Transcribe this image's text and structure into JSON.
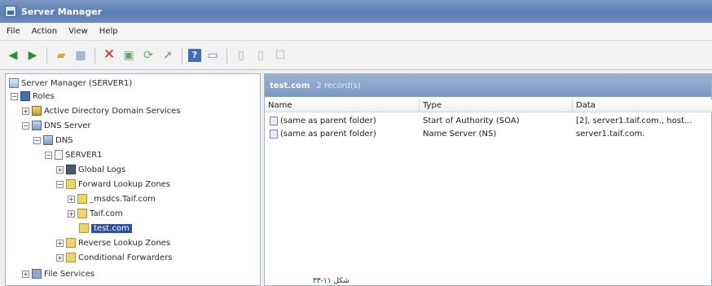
{
  "window": {
    "title": "Server Manager"
  },
  "menubar": {
    "items": [
      "File",
      "Action",
      "View",
      "Help"
    ]
  },
  "toolbar": {
    "back": "back-arrow-icon",
    "forward": "forward-arrow-icon",
    "up": "up-folder-icon",
    "show_hide": "show-hide-tree-icon",
    "delete": "delete-icon",
    "properties": "properties-icon",
    "refresh": "refresh-icon",
    "export": "export-list-icon",
    "help": "help-icon",
    "new_window": "new-window-icon"
  },
  "tree": {
    "root": "Server Manager (SERVER1)",
    "roles": "Roles",
    "ad": "Active Directory Domain Services",
    "dns_server": "DNS Server",
    "dns": "DNS",
    "server1": "SERVER1",
    "global_logs": "Global Logs",
    "forward_zones": "Forward Lookup Zones",
    "msdcs": "_msdcs.Taif.com",
    "taif": "Taif.com",
    "test": "test.com",
    "reverse_zones": "Reverse Lookup Zones",
    "conditional": "Conditional Forwarders",
    "file_services": "File Services"
  },
  "details": {
    "zone_name": "test.com",
    "record_count": "2 record(s)",
    "columns": [
      "Name",
      "Type",
      "Data"
    ],
    "rows": [
      {
        "name": "(same as parent folder)",
        "type": "Start of Authority (SOA)",
        "data": "[2], server1.taif.com., host..."
      },
      {
        "name": "(same as parent folder)",
        "type": "Name Server (NS)",
        "data": "server1.taif.com."
      }
    ]
  },
  "caption": "شکل ۱۱-۳۳"
}
